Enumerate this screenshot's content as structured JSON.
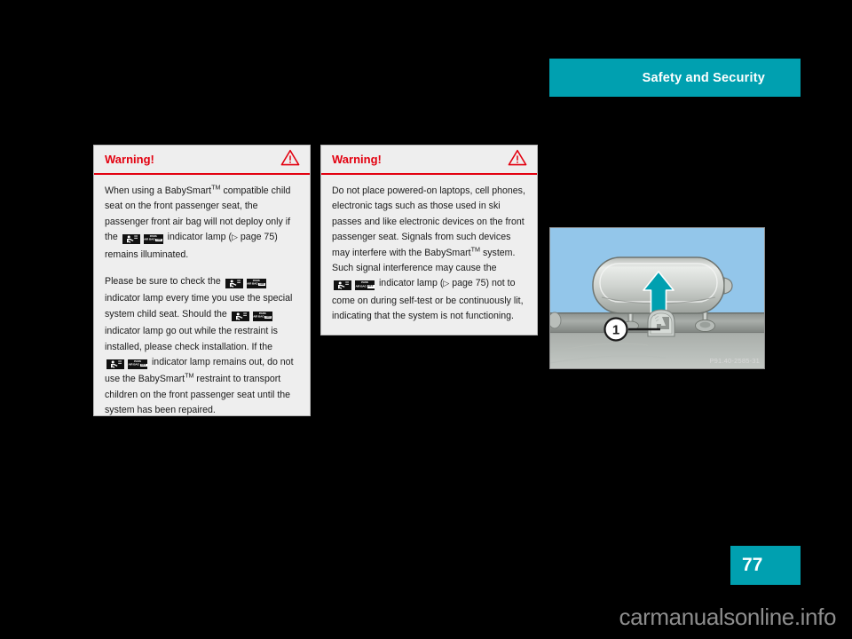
{
  "header": {
    "title": "Safety and Security",
    "accent_color": "#00A0B0"
  },
  "warnings": [
    {
      "title": "Warning!",
      "icon": "warning-triangle-icon",
      "accent_color": "#E3000F",
      "paragraphs": [
        {
          "segments": [
            {
              "type": "text",
              "value": "When using a BabySmart"
            },
            {
              "type": "sup",
              "value": "TM"
            },
            {
              "type": "text",
              "value": " compatible child seat on the front passenger seat, the passenger front air bag will not deploy only if the "
            },
            {
              "type": "lamp",
              "value": "indicator-lamp-badges"
            },
            {
              "type": "text",
              "value": " indicator lamp ("
            },
            {
              "type": "ref",
              "value": "page 75"
            },
            {
              "type": "text",
              "value": ") remains illuminated."
            }
          ]
        },
        {
          "segments": [
            {
              "type": "text",
              "value": "Please be sure to check the "
            },
            {
              "type": "lamp",
              "value": "indicator-lamp-badges"
            },
            {
              "type": "text",
              "value": " indicator lamp every time you use the special system child seat. Should the "
            },
            {
              "type": "lamp",
              "value": "indicator-lamp-badges"
            },
            {
              "type": "text",
              "value": " indicator lamp go out while the restraint is installed, please check installation. If the "
            },
            {
              "type": "lamp",
              "value": "indicator-lamp-badges"
            },
            {
              "type": "text",
              "value": " indicator lamp remains out, do not use the BabySmart"
            },
            {
              "type": "sup",
              "value": "TM"
            },
            {
              "type": "text",
              "value": " restraint to transport children on the front passenger seat until the system has been repaired."
            }
          ]
        }
      ]
    },
    {
      "title": "Warning!",
      "icon": "warning-triangle-icon",
      "accent_color": "#E3000F",
      "paragraphs": [
        {
          "segments": [
            {
              "type": "text",
              "value": "Do not place powered-on laptops, cell phones, electronic tags such as those used in ski passes and like electronic devices on the front passenger seat. Signals from such devices may interfere with the BabySmart"
            },
            {
              "type": "sup",
              "value": "TM"
            },
            {
              "type": "text",
              "value": " system. Such signal interference may cause the "
            },
            {
              "type": "lamp",
              "value": "indicator-lamp-badges"
            },
            {
              "type": "text",
              "value": " indicator lamp ("
            },
            {
              "type": "ref",
              "value": "page 75"
            },
            {
              "type": "text",
              "value": ") not to come on during self-test or be continuously lit, indicating that the system is not functioning."
            }
          ]
        }
      ]
    }
  ],
  "lamp_badges": {
    "child_seat_symbol": "child-in-seat-icon",
    "airbag_text_lines": [
      "PASS",
      "AIR BAG",
      "OFF"
    ]
  },
  "reference_marker": "▷",
  "figure": {
    "caption": "P91.40-2585-31",
    "callout_number": "1",
    "background_color": "#93C6EA",
    "arrow_color": "#00A0B0",
    "alt": "head restraint being lifted upward, child seat emblem at base"
  },
  "page_badge": {
    "number": "77",
    "color": "#00A0B0"
  },
  "watermark": {
    "text": "carmanualsonline.info"
  }
}
